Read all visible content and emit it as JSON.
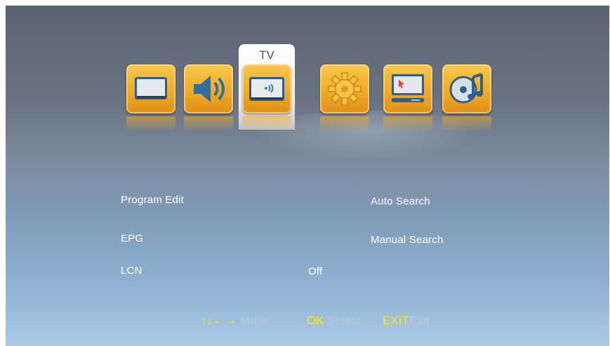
{
  "menu": {
    "selected_category": "TV",
    "icons": [
      {
        "name": "picture-icon"
      },
      {
        "name": "sound-icon"
      },
      {
        "name": "tv-icon"
      },
      {
        "name": "setup-gear-icon"
      },
      {
        "name": "pc-screen-icon"
      },
      {
        "name": "media-music-icon"
      }
    ]
  },
  "items": {
    "program_edit": "Program Edit",
    "epg": "EPG",
    "lcn": "LCN",
    "lcn_value": "Off",
    "auto_search": "Auto Search",
    "manual_search": "Manual Search"
  },
  "footer": {
    "move_keys": "↑↓←→",
    "move_label": "Move",
    "ok_key": "OK",
    "ok_label": "Select",
    "exit_key": "EXIT",
    "exit_label": "Exit"
  },
  "colors": {
    "tile": "#f0ab28",
    "key_hint": "#ffe600",
    "hint_text": "#b9c6d4"
  }
}
